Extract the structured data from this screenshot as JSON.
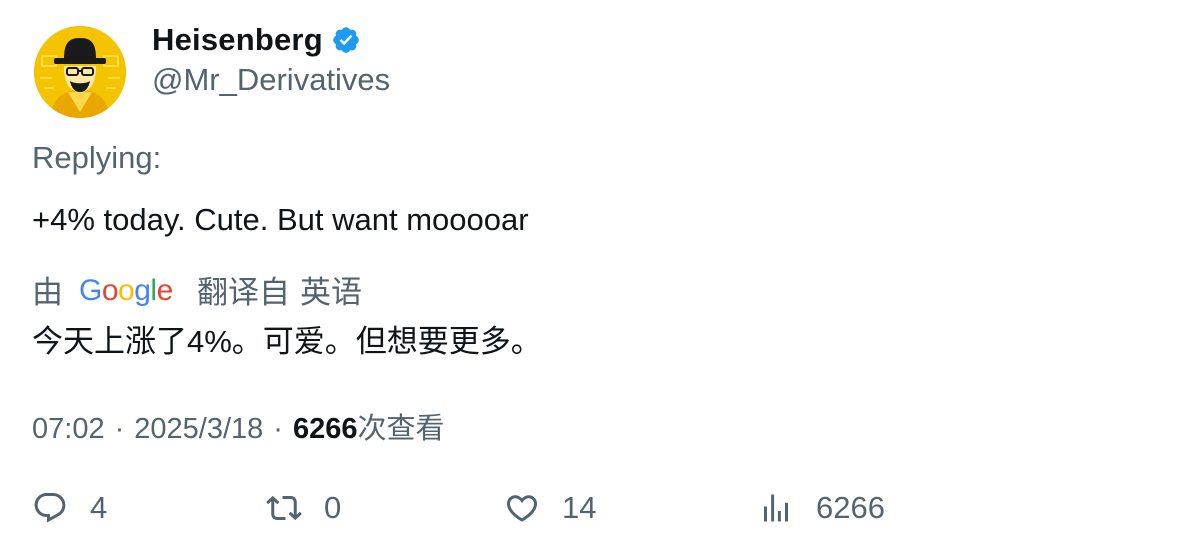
{
  "author": {
    "display_name": "Heisenberg",
    "handle": "@Mr_Derivatives",
    "verified_icon": "verified-badge-icon",
    "avatar_color": "#f5c400"
  },
  "replying_label": "Replying:",
  "tweet_text": "+4% today. Cute. But want mooooar",
  "translation": {
    "by_label": "由",
    "provider_logo": "Google",
    "translated_from_label": "翻译自",
    "source_language": "英语",
    "translated_text": "今天上涨了4%。可爱。但想要更多。"
  },
  "meta": {
    "time": "07:02",
    "separator": "·",
    "date": "2025/3/18",
    "views_count": "6266",
    "views_label": "次查看"
  },
  "actions": {
    "reply_count": "4",
    "retweet_count": "0",
    "like_count": "14",
    "views_count": "6266"
  },
  "colors": {
    "primary_text": "#0f1419",
    "secondary_text": "#536471",
    "verified": "#1d9bf0"
  }
}
